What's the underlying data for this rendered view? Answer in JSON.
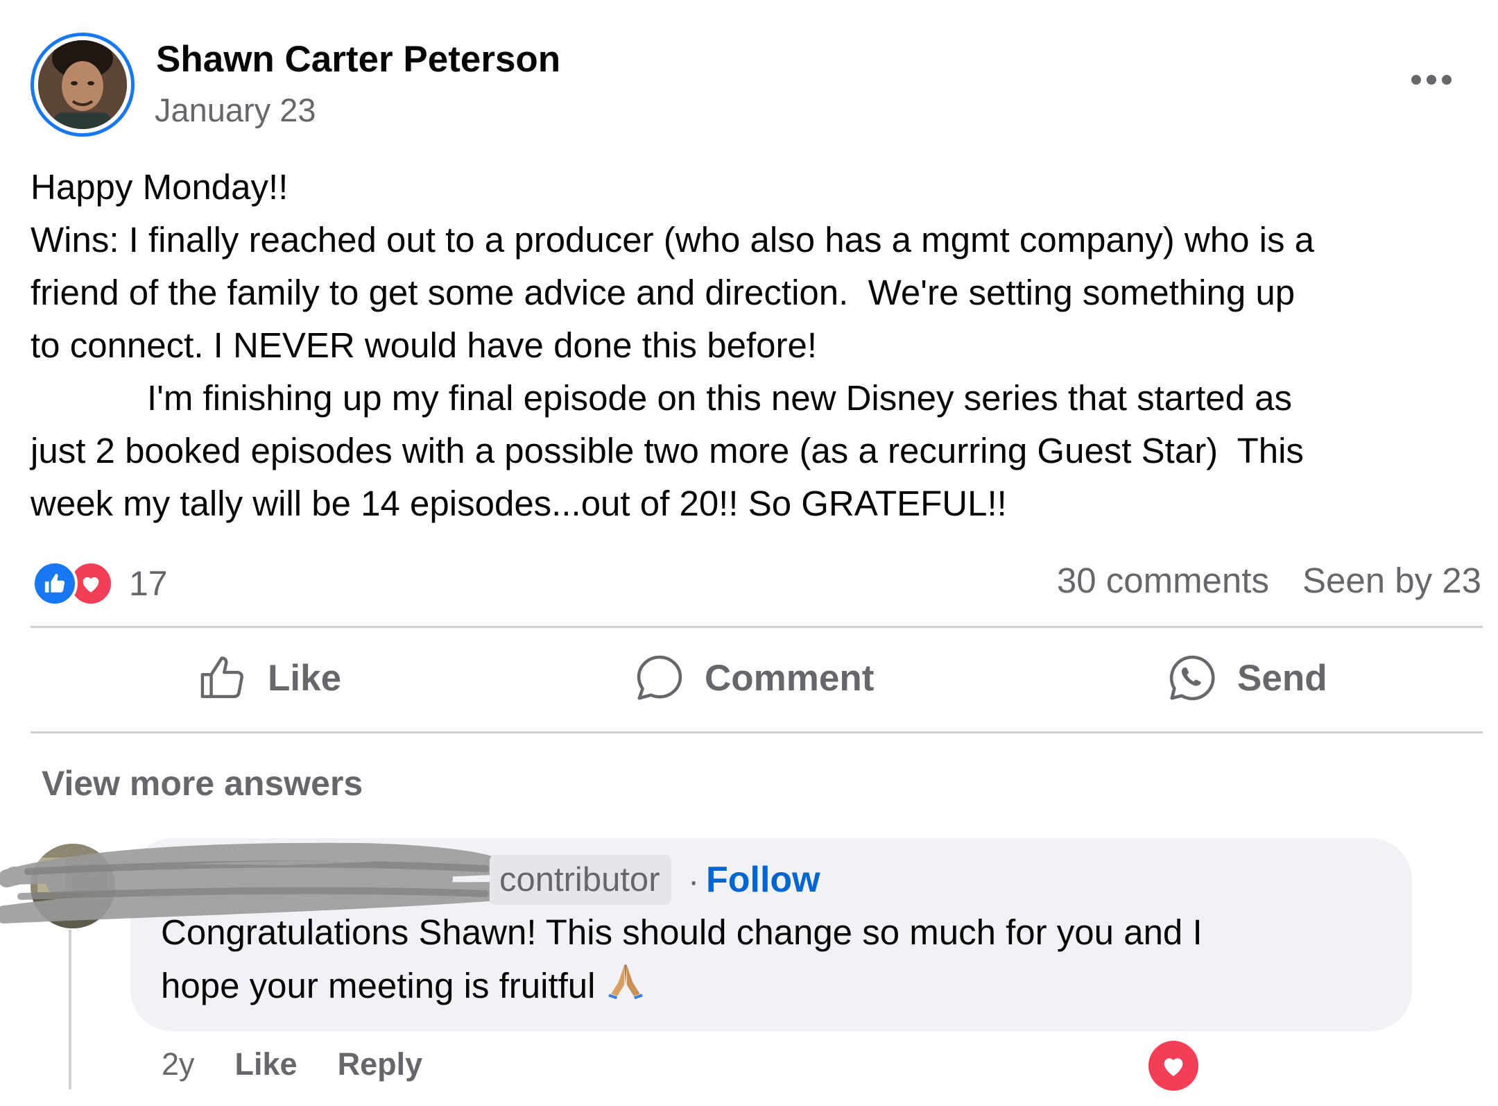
{
  "post": {
    "author": "Shawn Carter Peterson",
    "date": "January 23",
    "lines": [
      "Happy Monday!!",
      "Wins: I finally reached out to a producer (who also has a mgmt company) who is a",
      "friend of the family to get some advice and direction.  We're setting something up",
      "to connect. I NEVER would have done this before!",
      "I'm finishing up my final episode on this new Disney series that started as",
      "just 2 booked episodes with a possible two more (as a recurring Guest Star)  This",
      "week my tally will be 14 episodes...out of 20!! So GRATEFUL!!"
    ],
    "reaction_count": "17",
    "comments_count": "30 comments",
    "seen_by": "Seen by 23",
    "reactions": [
      "like-icon",
      "love-icon"
    ],
    "colors": {
      "like": "#1877f2",
      "love": "#f33e58",
      "ring": "#1877f2",
      "link": "#0064d1"
    }
  },
  "actions": {
    "like": "Like",
    "comment": "Comment",
    "send": "Send"
  },
  "view_more": "View more answers",
  "comment": {
    "badge": "contributor",
    "separator": "·",
    "follow": "Follow",
    "lines": [
      "Congratulations Shawn! This should change so much for you and I",
      "hope your meeting is fruitful"
    ],
    "emoji": "folded-hands-icon",
    "time": "2y",
    "like": "Like",
    "reply": "Reply"
  }
}
